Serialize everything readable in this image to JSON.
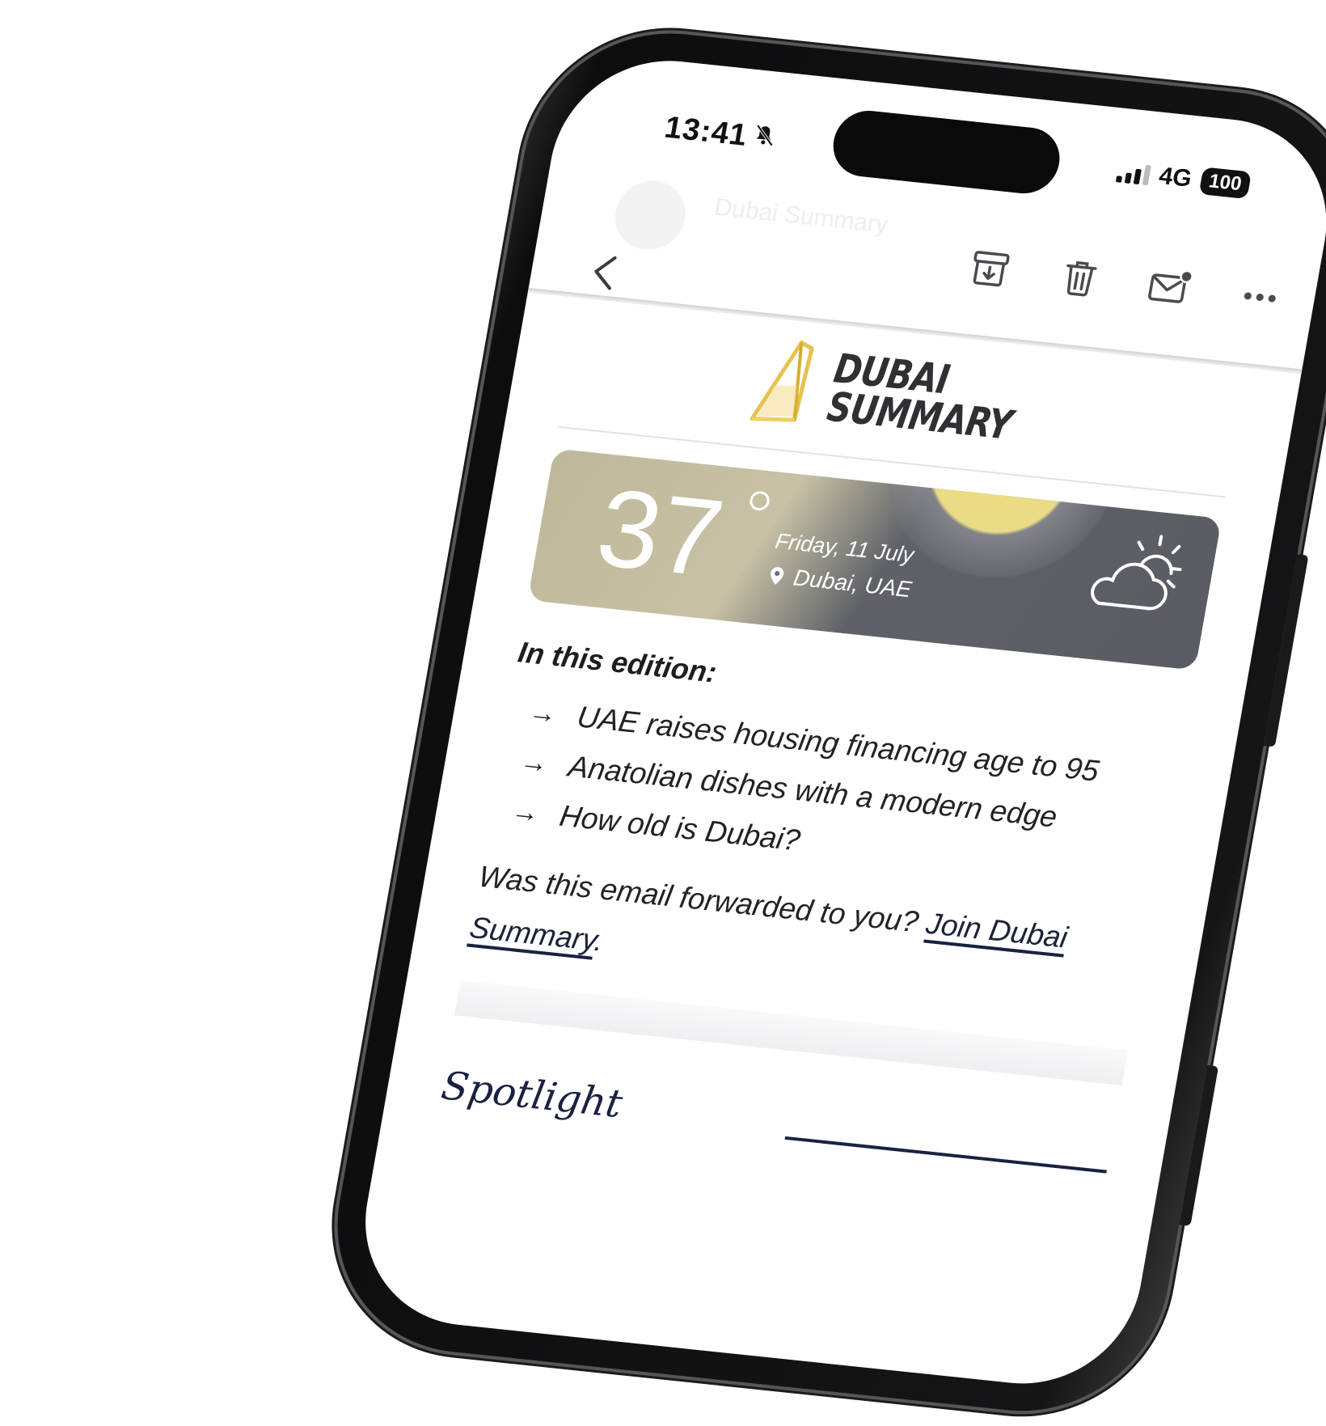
{
  "status_bar": {
    "time": "13:41",
    "bell_icon": "bell-slash-icon",
    "network": "4G",
    "battery": "100"
  },
  "mail_header": {
    "sender": "Dubai Summary",
    "actions": [
      {
        "name": "archive",
        "icon": "archive-icon"
      },
      {
        "name": "delete",
        "icon": "trash-icon"
      },
      {
        "name": "mark-unread",
        "icon": "envelope-dot-icon"
      },
      {
        "name": "more",
        "icon": "more-dots-icon"
      }
    ]
  },
  "newsletter": {
    "logo": {
      "line1": "DUBAI",
      "line2": "SUMMARY",
      "mark_color": "#e6c14d"
    },
    "weather": {
      "temperature": "37",
      "date": "Friday, 11 July",
      "location": "Dubai, UAE",
      "icon": "partly-sunny-icon"
    },
    "edition_heading": "In this edition:",
    "edition_items": [
      "UAE raises housing financing age to 95",
      "Anatolian dishes with a modern edge",
      "How old is Dubai?"
    ],
    "forward_text": "Was this email forwarded to you?",
    "forward_link_line1": "Join Dubai",
    "forward_link_line2": "Summary",
    "forward_end": ".",
    "spotlight_heading": "Spotlight"
  },
  "colors": {
    "accent_navy": "#1a2140",
    "logo_gold": "#e6c14d",
    "weather_gray": "#5c5e65",
    "weather_sand": "#c3bd9f"
  }
}
